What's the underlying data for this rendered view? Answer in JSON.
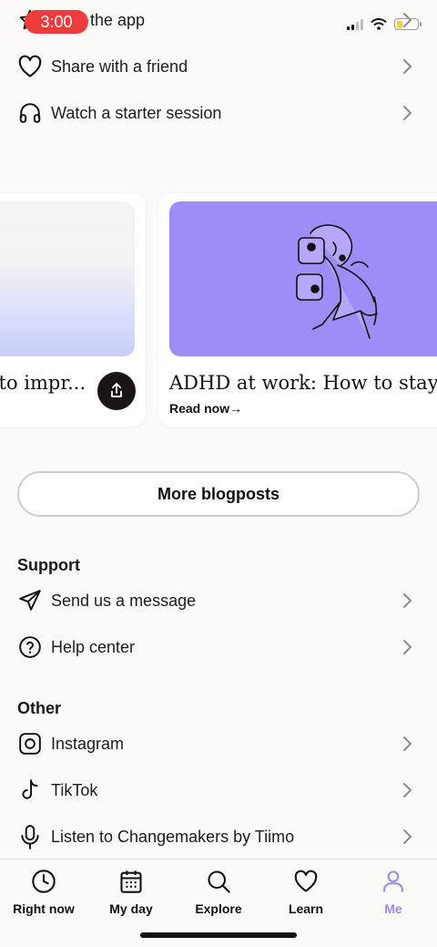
{
  "status": {
    "time": "3:00"
  },
  "top_rows": [
    {
      "label": "the app",
      "icon": "star-icon"
    },
    {
      "label": "Share with a friend",
      "icon": "heart-icon"
    },
    {
      "label": "Watch a starter session",
      "icon": "headphones-icon"
    }
  ],
  "blog": {
    "cards": [
      {
        "title": "y to impr...",
        "cta": ""
      },
      {
        "title": "ADHD at work: How to stay...",
        "cta": "Read now→"
      }
    ],
    "more_label": "More blogposts"
  },
  "support": {
    "title": "Support",
    "items": [
      {
        "label": "Send us a message",
        "icon": "send-icon"
      },
      {
        "label": "Help center",
        "icon": "help-circle-icon"
      }
    ]
  },
  "other": {
    "title": "Other",
    "items": [
      {
        "label": "Instagram",
        "icon": "instagram-icon"
      },
      {
        "label": "TikTok",
        "icon": "tiktok-icon"
      },
      {
        "label": "Listen to Changemakers by Tiimo",
        "icon": "microphone-icon"
      }
    ]
  },
  "tabs": [
    {
      "label": "Right now",
      "icon": "clock-icon"
    },
    {
      "label": "My day",
      "icon": "calendar-icon"
    },
    {
      "label": "Explore",
      "icon": "search-icon"
    },
    {
      "label": "Learn",
      "icon": "heart-icon"
    },
    {
      "label": "Me",
      "icon": "person-icon",
      "active": true
    }
  ],
  "colors": {
    "accent": "#9f88ee",
    "status_pill": "#ee3b3b",
    "card_purple": "#a08cf7"
  }
}
